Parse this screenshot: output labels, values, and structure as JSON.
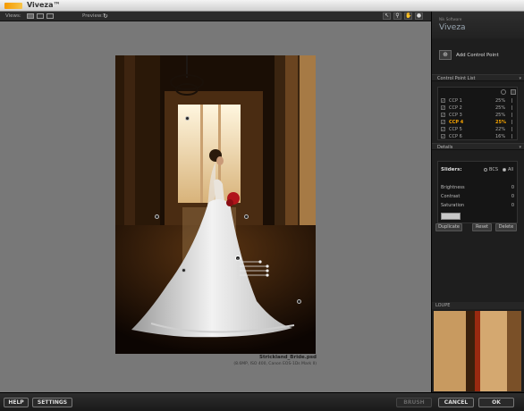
{
  "app": {
    "title": "Viveza™"
  },
  "toolbar": {
    "views_label": "Views:",
    "preview_label": "Preview:"
  },
  "photo": {
    "filename": "Strickland_Bride.psd",
    "info": "(8.6MP, ISO 400, Canon EOS-1Ds Mark II)"
  },
  "panel": {
    "vendor": "Nik Software",
    "title": "Viveza",
    "add_cp_label": "Add Control Point",
    "cp_list_header": "Control Point List",
    "control_points": [
      {
        "name": "CCP 1",
        "percent": "25%",
        "selected": false
      },
      {
        "name": "CCP 2",
        "percent": "25%",
        "selected": false
      },
      {
        "name": "CCP 3",
        "percent": "25%",
        "selected": false
      },
      {
        "name": "CCP 4",
        "percent": "25%",
        "selected": true
      },
      {
        "name": "CCP 5",
        "percent": "22%",
        "selected": false
      },
      {
        "name": "CCP 6",
        "percent": "16%",
        "selected": false
      }
    ],
    "details_header": "Details",
    "sliders_label": "Sliders:",
    "mode_bcs": "BCS",
    "mode_all": "All",
    "sliders": [
      {
        "name": "Brightness",
        "value": "0"
      },
      {
        "name": "Contrast",
        "value": "0"
      },
      {
        "name": "Saturation",
        "value": "0"
      }
    ],
    "duplicate_label": "Duplicate",
    "reset_label": "Reset",
    "delete_label": "Delete",
    "loupe_label": "LOUPE"
  },
  "bottom": {
    "help": "HELP",
    "settings": "SETTINGS",
    "brush": "BRUSH",
    "cancel": "CANCEL",
    "ok": "OK"
  },
  "colors": {
    "accent": "#f5a300",
    "canvas": "#787878",
    "panel": "#1e1e1e"
  }
}
